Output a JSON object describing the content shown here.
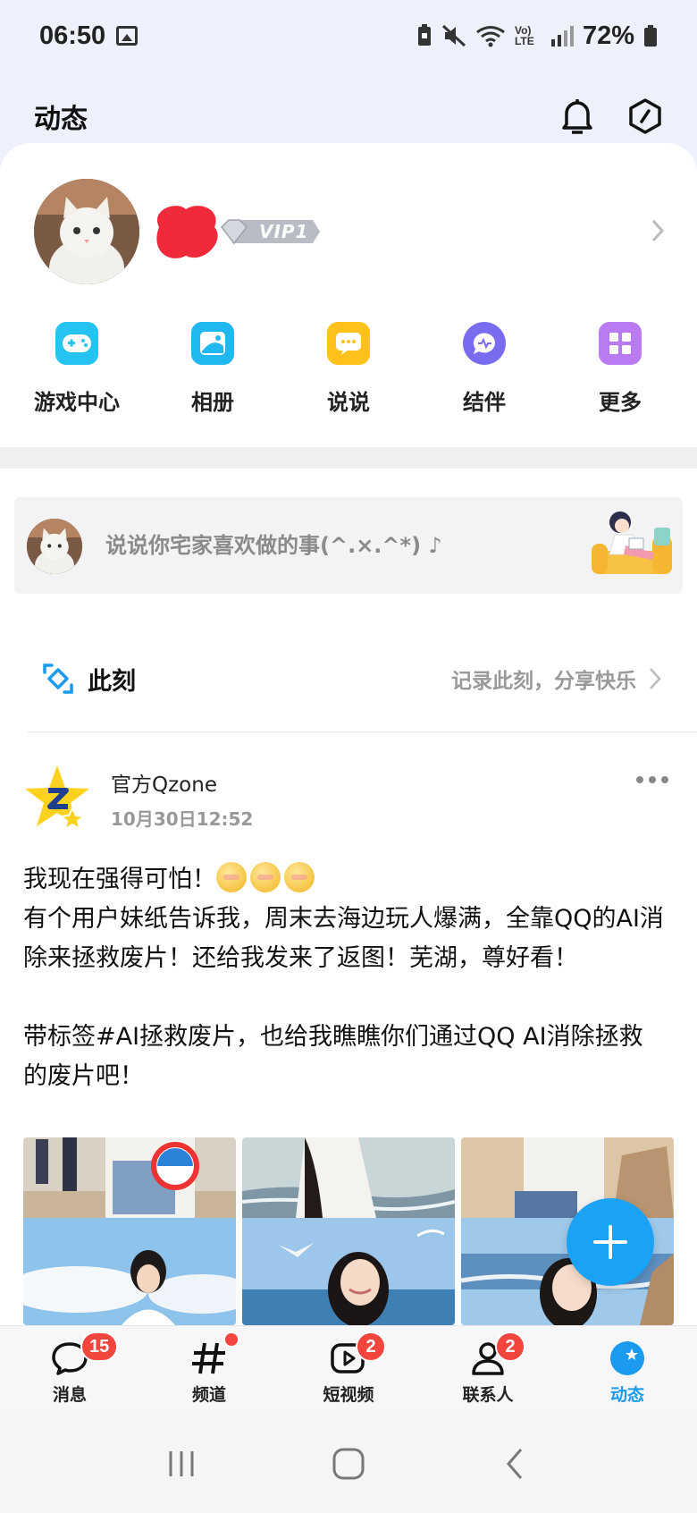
{
  "status_bar": {
    "time": "06:50",
    "battery_pct": "72%",
    "lte_label": "Vo) LTE"
  },
  "header": {
    "title": "动态"
  },
  "profile": {
    "vip_label": "VIP1"
  },
  "shortcuts": [
    {
      "label": "游戏中心",
      "icon": "gamepad-icon",
      "color": "#27c3f0"
    },
    {
      "label": "相册",
      "icon": "album-icon",
      "color": "#21b7ef"
    },
    {
      "label": "说说",
      "icon": "speech-bubble-icon",
      "color": "#ffc21a"
    },
    {
      "label": "结伴",
      "icon": "companion-icon",
      "color": "#7a6cf0"
    },
    {
      "label": "更多",
      "icon": "grid-icon",
      "color": "#b97af2"
    }
  ],
  "compose": {
    "placeholder": "说说你宅家喜欢做的事(^.×.^*) ♪"
  },
  "moment": {
    "title": "此刻",
    "hint": "记录此刻，分享快乐"
  },
  "post": {
    "author": "官方Qzone",
    "time": "10月30日12:52",
    "line1": "我现在强得可怕！",
    "paragraph1": "有个用户妹纸告诉我，周末去海边玩人爆满，全靠QQ的AI消除来拯救废片！还给我发来了返图！芜湖，尊好看！",
    "paragraph2": "带标签#AI拯救废片，也给我瞧瞧你们通过QQ AI消除拯救的废片吧！"
  },
  "tabs": [
    {
      "label": "消息",
      "badge": "15",
      "icon": "message-icon"
    },
    {
      "label": "频道",
      "badge": "",
      "icon": "hashtag-icon"
    },
    {
      "label": "短视频",
      "badge": "2",
      "icon": "video-icon"
    },
    {
      "label": "联系人",
      "badge": "2",
      "icon": "contacts-icon"
    },
    {
      "label": "动态",
      "badge": "",
      "icon": "qzone-star-icon"
    }
  ],
  "colors": {
    "accent": "#1a9bf0",
    "badge": "#f2453d",
    "fab": "#1aa3f5"
  }
}
